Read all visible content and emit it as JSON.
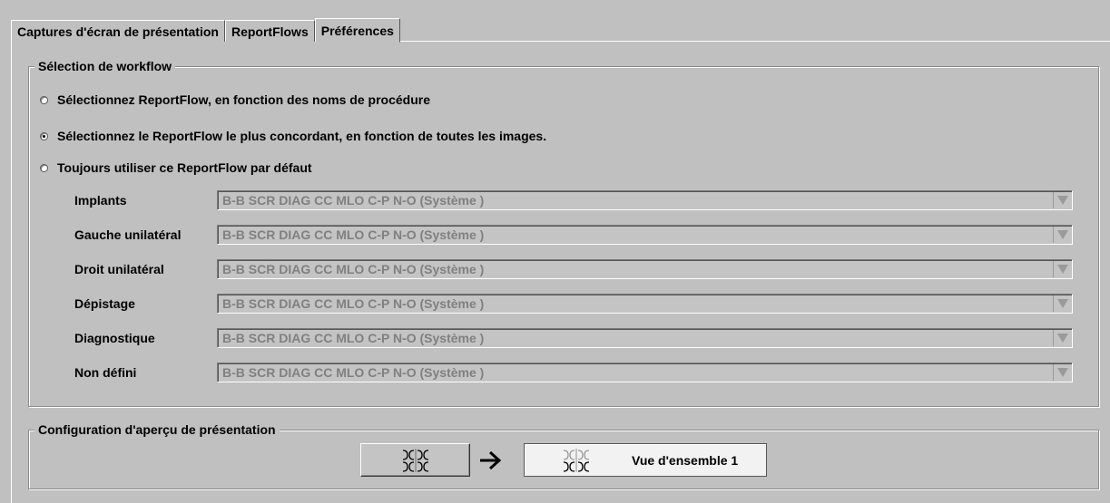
{
  "tabs": [
    {
      "label": "Captures d'écran de présentation",
      "active": false
    },
    {
      "label": "ReportFlows",
      "active": false
    },
    {
      "label": "Préférences",
      "active": true
    }
  ],
  "workflow": {
    "title": "Sélection de workflow",
    "options": [
      {
        "label": "Sélectionnez ReportFlow, en fonction des noms de procédure",
        "checked": false
      },
      {
        "label": "Sélectionnez le ReportFlow le plus concordant, en fonction de toutes les images.",
        "checked": true
      },
      {
        "label": "Toujours utiliser ce ReportFlow par défaut",
        "checked": false
      }
    ],
    "defaults": [
      {
        "label": "Implants",
        "value": "B-B SCR DIAG CC MLO C-P N-O (Système )"
      },
      {
        "label": "Gauche unilatéral",
        "value": "B-B SCR DIAG CC MLO C-P N-O (Système )"
      },
      {
        "label": "Droit unilatéral",
        "value": "B-B SCR DIAG CC MLO C-P N-O (Système )"
      },
      {
        "label": "Dépistage",
        "value": "B-B SCR DIAG CC MLO C-P N-O (Système )"
      },
      {
        "label": "Diagnostique",
        "value": "B-B SCR DIAG CC MLO C-P N-O (Système )"
      },
      {
        "label": "Non défini",
        "value": "B-B SCR DIAG CC MLO C-P N-O (Système )"
      }
    ]
  },
  "preview": {
    "title": "Configuration d'aperçu de présentation",
    "target_label": "Vue d'ensemble 1",
    "source_icon": "breast-layout-icon",
    "arrow_icon": "right-arrow-icon",
    "target_icon": "breast-layout-icon"
  }
}
